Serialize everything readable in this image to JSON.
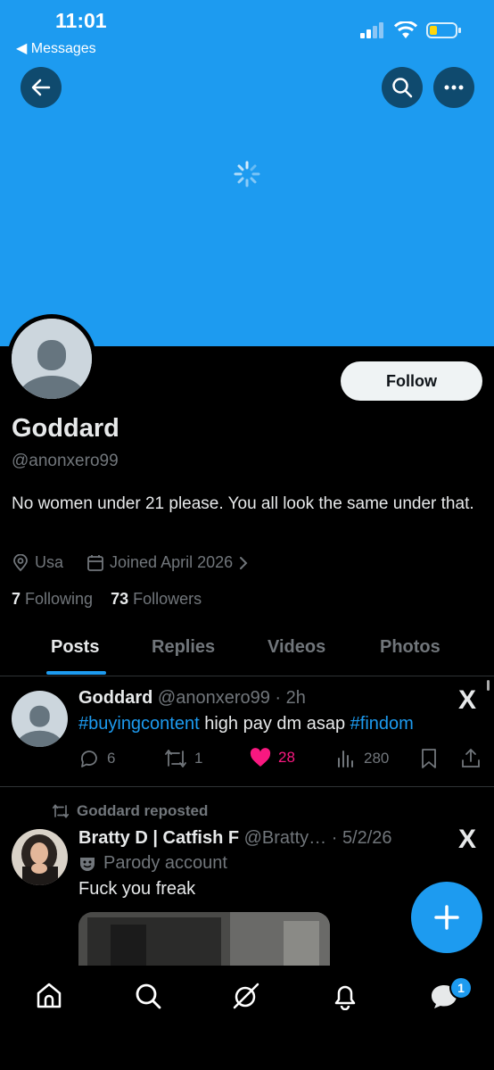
{
  "status_bar": {
    "time": "11:01",
    "back_app": "◀ Messages"
  },
  "header": {
    "back_icon": "arrow-left-icon",
    "search_icon": "search-icon",
    "more_icon": "more-icon"
  },
  "profile": {
    "name": "Goddard",
    "handle": "@anonxero99",
    "bio": "No women under 21 please. You all look the same under that.",
    "location": "Usa",
    "joined": "Joined April 2026",
    "following_count": "7",
    "following_label": "Following",
    "followers_count": "73",
    "followers_label": "Followers",
    "follow_button": "Follow"
  },
  "tabs": [
    "Posts",
    "Replies",
    "Videos",
    "Photos"
  ],
  "posts": [
    {
      "author": "Goddard",
      "handle_time": "@anonxero99 · 2h",
      "text_parts": [
        "#buyingcontent",
        " high pay dm asap ",
        "#findom"
      ],
      "replies": "6",
      "reposts": "1",
      "likes": "28",
      "views": "280"
    },
    {
      "repost_label": "Goddard reposted",
      "author": "Bratty D | Catfish F",
      "handle_time": "@Bratty… · 5/2/26",
      "parody_label": "Parody account",
      "text": "Fuck you freak"
    }
  ],
  "x_logo": "X",
  "notifications_badge": "1",
  "colors": {
    "accent": "#1d9bf0",
    "like": "#f91880",
    "muted": "#71767b"
  }
}
